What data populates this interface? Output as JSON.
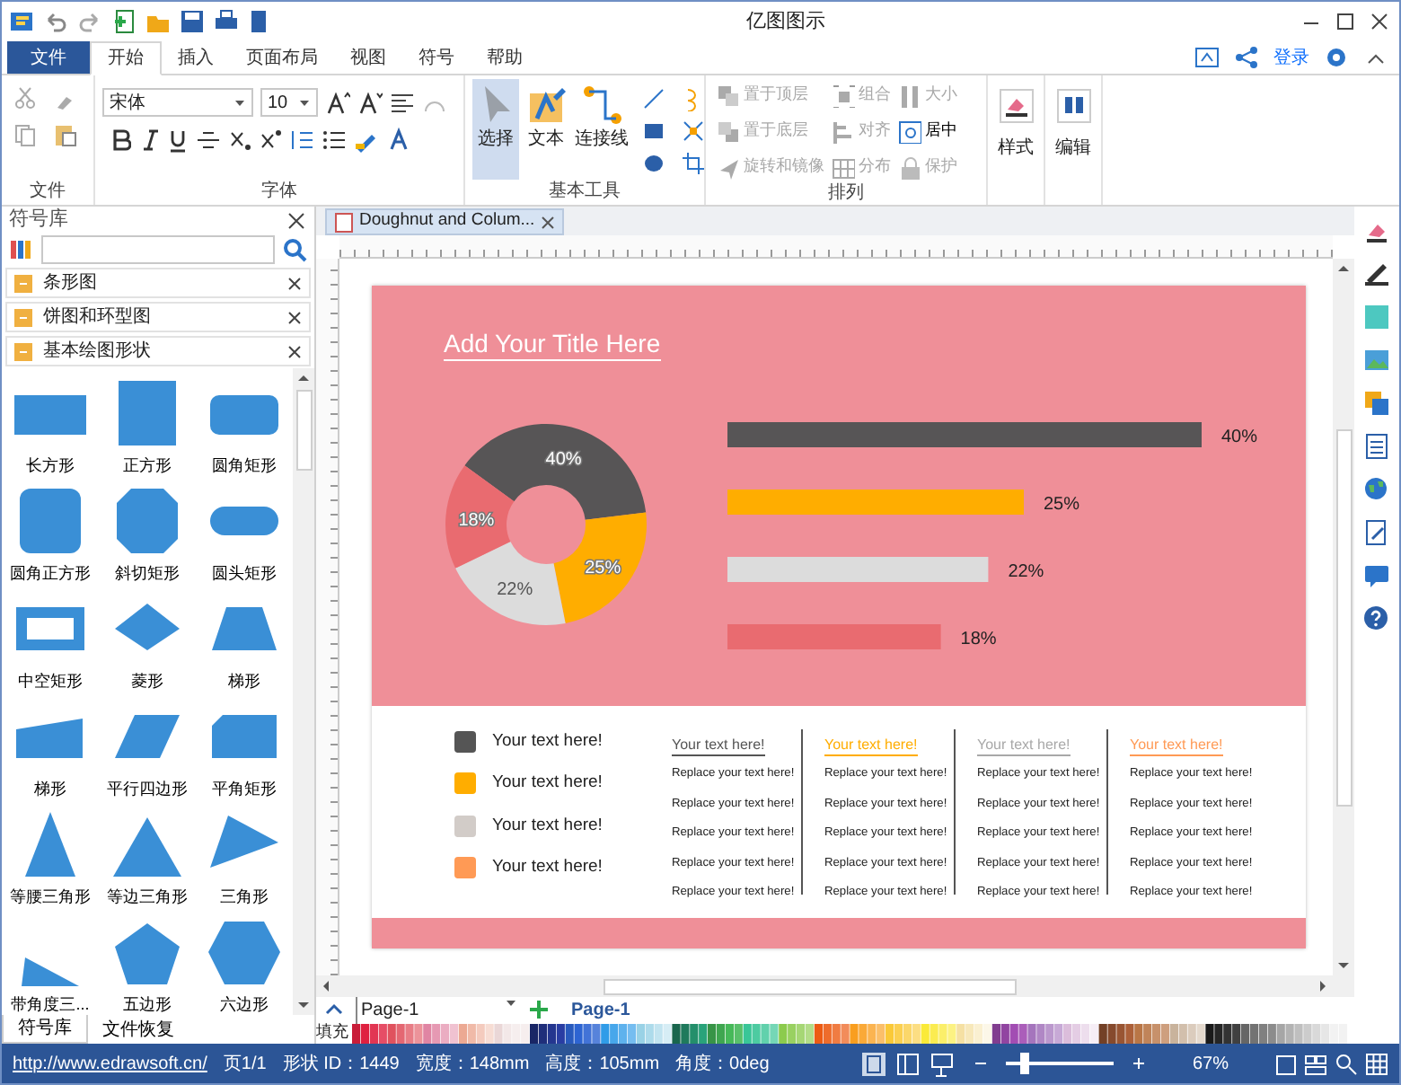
{
  "window": {
    "title": "亿图图示"
  },
  "menu_tabs": [
    {
      "label": "文件",
      "kind": "file",
      "selected": false
    },
    {
      "label": "开始",
      "kind": "tab",
      "selected": true
    },
    {
      "label": "插入",
      "kind": "tab",
      "selected": false
    },
    {
      "label": "页面布局",
      "kind": "tab",
      "selected": false
    },
    {
      "label": "视图",
      "kind": "tab",
      "selected": false
    },
    {
      "label": "符号",
      "kind": "tab",
      "selected": false
    },
    {
      "label": "帮助",
      "kind": "tab",
      "selected": false
    }
  ],
  "account": {
    "login": "登录"
  },
  "ribbon": {
    "file_group": {
      "label": "文件"
    },
    "font_group": {
      "label": "字体",
      "font": "宋体",
      "size": "10"
    },
    "tools_group": {
      "label": "基本工具",
      "tools": [
        {
          "label": "选择",
          "selected": true
        },
        {
          "label": "文本",
          "selected": false
        },
        {
          "label": "连接线",
          "selected": false
        }
      ]
    },
    "arrange_group": {
      "label": "排列",
      "items": [
        {
          "label": "置于顶层",
          "disabled": true
        },
        {
          "label": "置于底层",
          "disabled": true
        },
        {
          "label": "旋转和镜像",
          "disabled": true
        },
        {
          "label": "组合",
          "disabled": true
        },
        {
          "label": "对齐",
          "disabled": true
        },
        {
          "label": "分布",
          "disabled": true
        },
        {
          "label": "大小",
          "disabled": true
        },
        {
          "label": "居中",
          "disabled": false
        },
        {
          "label": "保护",
          "disabled": true
        }
      ]
    },
    "style_group": {
      "label": "样式"
    },
    "edit_group": {
      "label": "编辑"
    }
  },
  "symbol_library": {
    "title": "符号库",
    "libraries": [
      "条形图",
      "饼图和环型图",
      "基本绘图形状"
    ],
    "shapes": [
      {
        "label": "长方形",
        "kind": "rect"
      },
      {
        "label": "正方形",
        "kind": "square"
      },
      {
        "label": "圆角矩形",
        "kind": "rounded"
      },
      {
        "label": "圆角正方形",
        "kind": "roundsquare"
      },
      {
        "label": "斜切矩形",
        "kind": "octagon"
      },
      {
        "label": "圆头矩形",
        "kind": "stadium"
      },
      {
        "label": "中空矩形",
        "kind": "hollow"
      },
      {
        "label": "菱形",
        "kind": "diamond"
      },
      {
        "label": "梯形",
        "kind": "trapezoid"
      },
      {
        "label": "梯形",
        "kind": "wedge"
      },
      {
        "label": "平行四边形",
        "kind": "parallelogram"
      },
      {
        "label": "平角矩形",
        "kind": "cutcorner"
      },
      {
        "label": "等腰三角形",
        "kind": "isosceles"
      },
      {
        "label": "等边三角形",
        "kind": "equilateral"
      },
      {
        "label": "三角形",
        "kind": "triangle"
      },
      {
        "label": "带角度三...",
        "kind": "righttriangle"
      },
      {
        "label": "五边形",
        "kind": "pentagon"
      },
      {
        "label": "六边形",
        "kind": "hexagon"
      }
    ],
    "tabs": [
      {
        "label": "符号库",
        "selected": true
      },
      {
        "label": "文件恢复",
        "selected": false
      }
    ]
  },
  "document": {
    "tab": "Doughnut and Colum...",
    "slide": {
      "title": "Add Your Title Here",
      "donut": {
        "chart_data": {
          "type": "donut",
          "values": [
            40,
            25,
            22,
            18
          ],
          "colors": [
            "#575556",
            "#ffad00",
            "#dcdcdc",
            "#e96b70"
          ],
          "value_labels": [
            "40%",
            "25%",
            "22%",
            "18%"
          ]
        }
      },
      "bars": {
        "chart_data": {
          "type": "bar",
          "orientation": "horizontal",
          "values": [
            40,
            25,
            22,
            18
          ],
          "colors": [
            "#575556",
            "#ffad00",
            "#dcdcdc",
            "#e96b70"
          ],
          "value_labels": [
            "40%",
            "25%",
            "22%",
            "18%"
          ]
        }
      },
      "legend": [
        {
          "label": "Your text here!",
          "color": "#555555"
        },
        {
          "label": "Your text here!",
          "color": "#ffad00"
        },
        {
          "label": "Your text here!",
          "color": "#d2ccc8"
        },
        {
          "label": "Your text here!",
          "color": "#ff9a55"
        }
      ],
      "columns": [
        {
          "heading": "Your text here!",
          "color": "#555555",
          "lines": [
            "Replace your text here!",
            "Replace your text here!",
            "Replace your text here!",
            "Replace your text here!",
            "Replace your text here!"
          ]
        },
        {
          "heading": "Your text here!",
          "color": "#ffad00",
          "lines": [
            "Replace your text here!",
            "Replace your text here!",
            "Replace your text here!",
            "Replace your text here!",
            "Replace your text here!"
          ]
        },
        {
          "heading": "Your text here!",
          "color": "#a8a8a8",
          "lines": [
            "Replace your text here!",
            "Replace your text here!",
            "Replace your text here!",
            "Replace your text here!",
            "Replace your text here!"
          ]
        },
        {
          "heading": "Your text here!",
          "color": "#ff9a55",
          "lines": [
            "Replace your text here!",
            "Replace your text here!",
            "Replace your text here!",
            "Replace your text here!",
            "Replace your text here!"
          ]
        }
      ]
    }
  },
  "pages": {
    "selector": "Page-1",
    "tabs": [
      {
        "label": "Page-1",
        "selected": true
      }
    ]
  },
  "palette": {
    "label": "填充"
  },
  "status_bar": {
    "link": "http://www.edrawsoft.cn/",
    "page": "页1/1",
    "shape_id": "形状 ID：1449",
    "width": "宽度：148mm",
    "height": "高度：105mm",
    "angle": "角度：0deg",
    "zoom": "67%",
    "zoom_slider": {
      "level": 0.16
    }
  }
}
